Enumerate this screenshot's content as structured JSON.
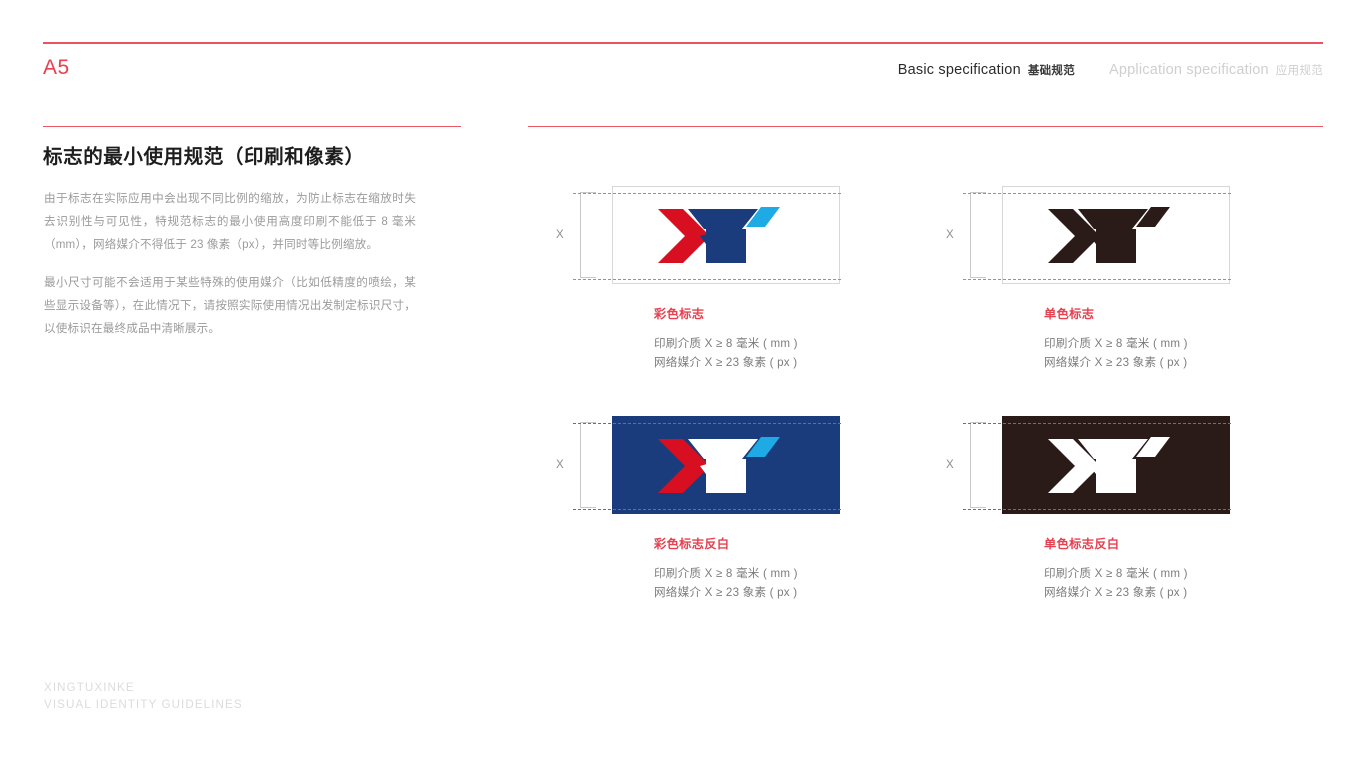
{
  "header": {
    "page_code": "A5",
    "nav": [
      {
        "en": "Basic specification",
        "cn": "基础规范",
        "state": "active"
      },
      {
        "en": "Application specification",
        "cn": "应用规范",
        "state": "inactive"
      }
    ]
  },
  "content": {
    "section_title": "标志的最小使用规范（印刷和像素）",
    "paragraph_1": "由于标志在实际应用中会出现不同比例的缩放，为防止标志在缩放时失去识别性与可见性，特规范标志的最小使用高度印刷不能低于 8 毫米（mm），网络媒介不得低于 23 像素（px），并同时等比例缩放。",
    "paragraph_2": "最小尺寸可能不会适用于某些特殊的使用媒介（比如低精度的喷绘，某些显示设备等），在此情况下，请按照实际使用情况出发制定标识尺寸，以使标识在最终成品中清晰展示。"
  },
  "measure_label": "X",
  "specimens": [
    {
      "id": "color-logo",
      "background": "white",
      "caption_title": "彩色标志",
      "spec_print": "印刷介质 X ≥ 8 毫米 ( mm )",
      "spec_web": "网络媒介 X ≥ 23 象素 ( px )"
    },
    {
      "id": "mono-logo",
      "background": "white",
      "caption_title": "单色标志",
      "spec_print": "印刷介质 X ≥ 8 毫米 ( mm )",
      "spec_web": "网络媒介 X ≥ 23 象素 ( px )"
    },
    {
      "id": "color-logo-reversed",
      "background": "navy",
      "caption_title": "彩色标志反白",
      "spec_print": "印刷介质 X ≥ 8 毫米 ( mm )",
      "spec_web": "网络媒介 X ≥ 23 象素 ( px )"
    },
    {
      "id": "mono-logo-reversed",
      "background": "brown",
      "caption_title": "单色标志反白",
      "spec_print": "印刷介质 X ≥ 8 毫米 ( mm )",
      "spec_web": "网络媒介 X ≥ 23 象素 ( px )"
    }
  ],
  "footer": {
    "line1": "XINGTUXINKE",
    "line2": "VISUAL IDENTITY GUIDELINES"
  },
  "colors": {
    "accent_red": "#e8404f",
    "rule_red": "#ea5260",
    "logo_red": "#d80f20",
    "logo_navy": "#1a3b7c",
    "logo_cyan": "#1eaae4",
    "mono_dark": "#2a1a18",
    "reverse_white": "#ffffff",
    "guide_dash": "#ef6a72",
    "body_gray": "#9b9b9b",
    "footer_gray": "#dcdcdc"
  }
}
